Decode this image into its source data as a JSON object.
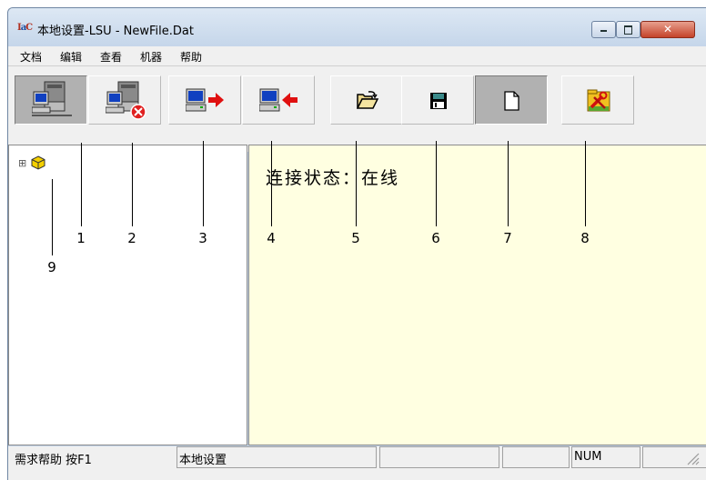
{
  "window": {
    "icon_text": "IaC",
    "title": "本地设置-LSU - NewFile.Dat",
    "minimize_glyph": "▭",
    "maximize_glyph": "□",
    "close_glyph": "✕"
  },
  "menu": [
    "文档",
    "编辑",
    "查看",
    "机器",
    "帮助"
  ],
  "toolbar": {
    "buttons": [
      {
        "icon": "connect-machine-icon",
        "pressed": true
      },
      {
        "icon": "disconnect-machine-icon",
        "pressed": false
      },
      {
        "icon": "upload-to-device-icon",
        "pressed": false
      },
      {
        "icon": "download-from-device-icon",
        "pressed": false
      },
      {
        "icon": "open-folder-icon",
        "pressed": false
      },
      {
        "icon": "save-floppy-icon",
        "pressed": false
      },
      {
        "icon": "new-document-icon",
        "pressed": true
      },
      {
        "icon": "settings-tools-icon",
        "pressed": false
      }
    ]
  },
  "tree": {
    "expander": "⊞",
    "root_icon": "gold-box-icon"
  },
  "content": {
    "status_label": "连接状态：在线"
  },
  "callouts": [
    "1",
    "2",
    "3",
    "4",
    "5",
    "6",
    "7",
    "8",
    "9"
  ],
  "statusbar": {
    "help": "需求帮助 按F1",
    "mode": "本地设置",
    "panel3": "",
    "panel4": "",
    "num": "NUM",
    "panel6": ""
  }
}
